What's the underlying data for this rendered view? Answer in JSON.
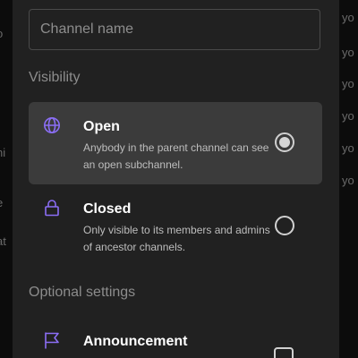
{
  "background": {
    "left_fragments": [
      "o",
      "ni",
      "e",
      "l",
      "at"
    ],
    "right_fragments": [
      "yo",
      "yo",
      "yo",
      "yo",
      "yo",
      "yo"
    ]
  },
  "form": {
    "channel_name_placeholder": "Channel name",
    "channel_name_value": ""
  },
  "visibility": {
    "title": "Visibility",
    "options": [
      {
        "title": "Open",
        "description": "Anybody in the parent channel can see an open subchannel.",
        "icon": "globe-icon",
        "selected": true
      },
      {
        "title": "Closed",
        "description": "Only visible to its members and admins of ancestor channels.",
        "icon": "lock-icon",
        "selected": false
      }
    ]
  },
  "optional_settings": {
    "title": "Optional settings",
    "items": [
      {
        "title": "Announcement",
        "icon": "flag-icon",
        "checked": false
      }
    ]
  },
  "colors": {
    "accent": "#8b6ef5",
    "sheet_background": "#212121",
    "selected_row": "#3b3b3b"
  }
}
